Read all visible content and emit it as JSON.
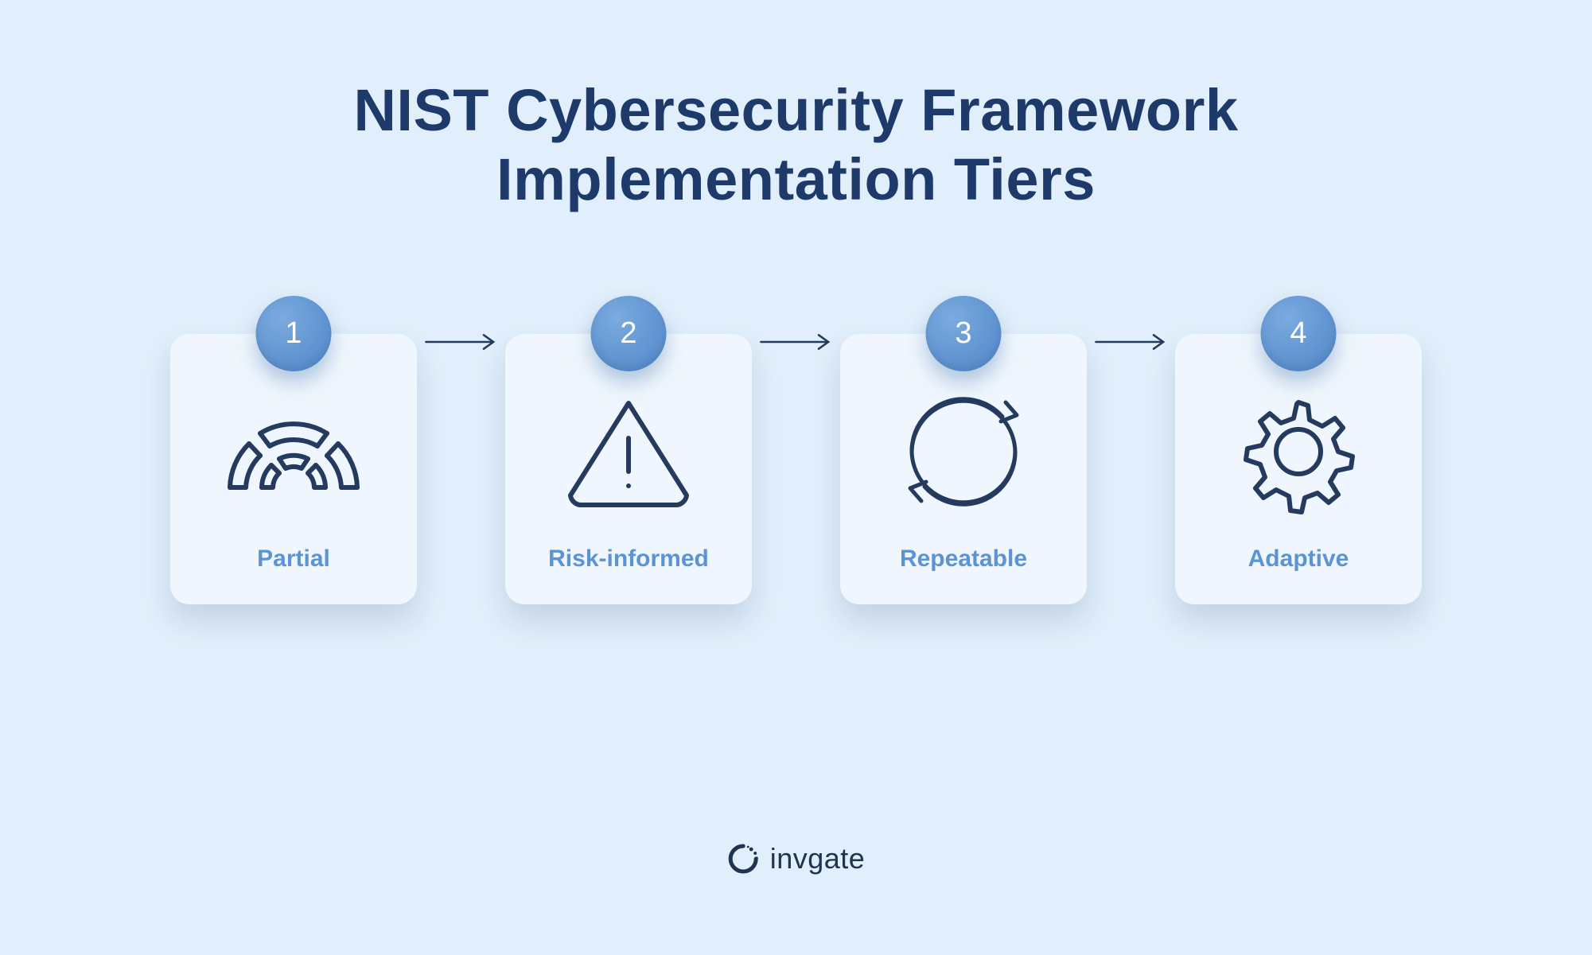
{
  "title_line1": "NIST Cybersecurity Framework",
  "title_line2": "Implementation Tiers",
  "tiers": [
    {
      "num": "1",
      "label": "Partial",
      "icon": "gauge"
    },
    {
      "num": "2",
      "label": "Risk-informed",
      "icon": "warning"
    },
    {
      "num": "3",
      "label": "Repeatable",
      "icon": "cycle"
    },
    {
      "num": "4",
      "label": "Adaptive",
      "icon": "gear"
    }
  ],
  "brand": "invgate",
  "colors": {
    "background": "#e1eefb",
    "card": "#eff6fd",
    "title": "#1d3a6a",
    "accent": "#5b93d4",
    "iconStroke": "#243a5f"
  }
}
